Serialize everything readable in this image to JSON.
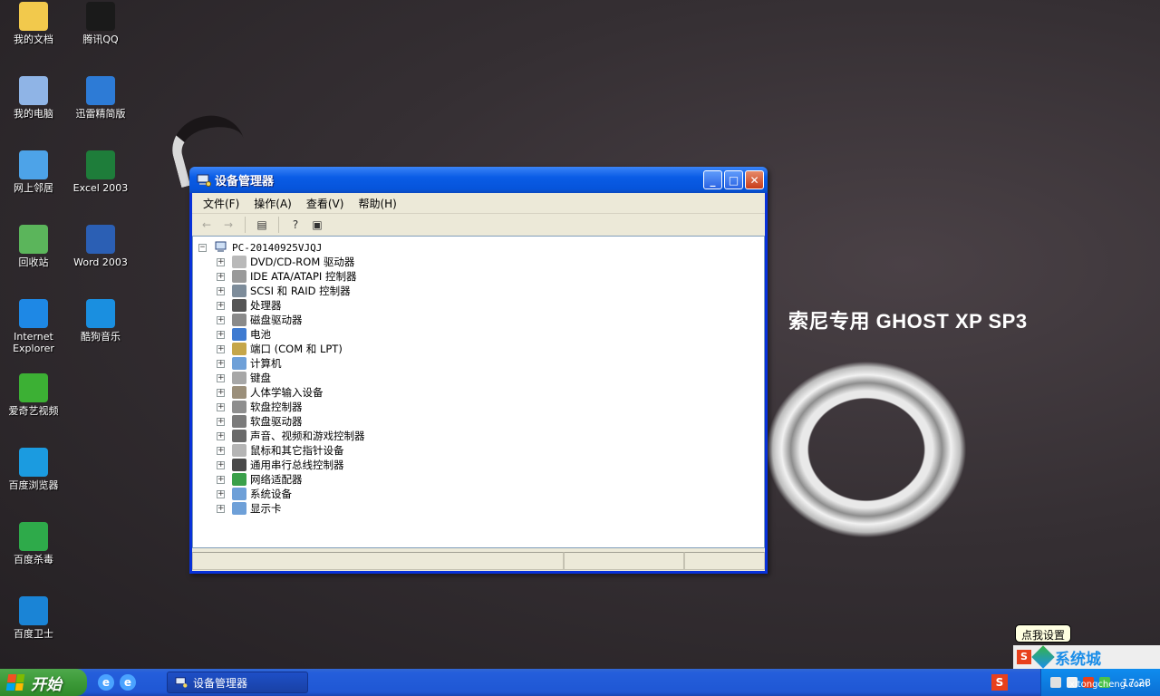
{
  "desktop": {
    "brand_title": "索尼专用 GHOST XP SP3",
    "icons": [
      {
        "label": "我的文档",
        "icon": "folder-icon",
        "color": "#f2c94c"
      },
      {
        "label": "腾讯QQ",
        "icon": "qq-penguin-icon",
        "color": "#1a1a1a"
      },
      {
        "label": "我的电脑",
        "icon": "computer-icon",
        "color": "#8fb4e6"
      },
      {
        "label": "迅雷精简版",
        "icon": "thunder-bird-icon",
        "color": "#2d7bd6"
      },
      {
        "label": "网上邻居",
        "icon": "network-icon",
        "color": "#4da3e8"
      },
      {
        "label": "Excel 2003",
        "icon": "excel-icon",
        "color": "#1e7d3a"
      },
      {
        "label": "回收站",
        "icon": "recycle-bin-icon",
        "color": "#5bb55b"
      },
      {
        "label": "Word 2003",
        "icon": "word-icon",
        "color": "#2b5fb4"
      },
      {
        "label": "Internet Explorer",
        "icon": "ie-icon",
        "color": "#1e88e5"
      },
      {
        "label": "酷狗音乐",
        "icon": "kugou-icon",
        "color": "#1a8fe0"
      },
      {
        "label": "爱奇艺视频",
        "icon": "iqiyi-icon",
        "color": "#3cb034"
      },
      {
        "label": "百度浏览器",
        "icon": "baidu-browser-icon",
        "color": "#1b9be0"
      },
      {
        "label": "百度杀毒",
        "icon": "baidu-antivirus-icon",
        "color": "#2eaa4a"
      },
      {
        "label": "百度卫士",
        "icon": "baidu-guard-icon",
        "color": "#1a84d6"
      }
    ]
  },
  "window": {
    "title": "设备管理器",
    "controls": {
      "minimize": "_",
      "maximize": "□",
      "close": "✕"
    },
    "menu": [
      "文件(F)",
      "操作(A)",
      "查看(V)",
      "帮助(H)"
    ],
    "toolbar": {
      "back": "←",
      "forward": "→",
      "properties": "▤",
      "help": "?",
      "view": "▣"
    },
    "tree": {
      "root_expander": "−",
      "item_expander": "+",
      "root": "PC-20140925VJQJ",
      "items": [
        {
          "label": "DVD/CD-ROM 驱动器",
          "icon": "cdrom-icon",
          "color": "#b9b9b9"
        },
        {
          "label": "IDE ATA/ATAPI 控制器",
          "icon": "ide-controller-icon",
          "color": "#9a9a9a"
        },
        {
          "label": "SCSI 和 RAID 控制器",
          "icon": "scsi-controller-icon",
          "color": "#7d8c9a"
        },
        {
          "label": "处理器",
          "icon": "processor-icon",
          "color": "#555555"
        },
        {
          "label": "磁盘驱动器",
          "icon": "disk-drive-icon",
          "color": "#8a8a8a"
        },
        {
          "label": "电池",
          "icon": "battery-icon",
          "color": "#3f7bd1"
        },
        {
          "label": "端口 (COM 和 LPT)",
          "icon": "port-icon",
          "color": "#c5a64a"
        },
        {
          "label": "计算机",
          "icon": "computer-icon",
          "color": "#6ea0d8"
        },
        {
          "label": "键盘",
          "icon": "keyboard-icon",
          "color": "#a7a7a7"
        },
        {
          "label": "人体学输入设备",
          "icon": "hid-icon",
          "color": "#9b8f7a"
        },
        {
          "label": "软盘控制器",
          "icon": "floppy-controller-icon",
          "color": "#8e8e8e"
        },
        {
          "label": "软盘驱动器",
          "icon": "floppy-drive-icon",
          "color": "#7b7b7b"
        },
        {
          "label": "声音、视频和游戏控制器",
          "icon": "sound-icon",
          "color": "#6a6a6a"
        },
        {
          "label": "鼠标和其它指针设备",
          "icon": "mouse-icon",
          "color": "#b5b5b5"
        },
        {
          "label": "通用串行总线控制器",
          "icon": "usb-icon",
          "color": "#4a4a4a"
        },
        {
          "label": "网络适配器",
          "icon": "network-adapter-icon",
          "color": "#3aa04a"
        },
        {
          "label": "系统设备",
          "icon": "system-device-icon",
          "color": "#6ea0d8"
        },
        {
          "label": "显示卡",
          "icon": "display-adapter-icon",
          "color": "#6ea0d8"
        }
      ]
    }
  },
  "taskbar": {
    "start_label": "开始",
    "quick_launch": [
      {
        "icon": "ie-quick-icon",
        "glyph": "e"
      },
      {
        "icon": "browser-quick-icon",
        "glyph": "e"
      }
    ],
    "task_label": "设备管理器",
    "tray_s": "S",
    "clock": "17:28",
    "balloon": "点我设置",
    "watermark_text": "系统城",
    "watermark_logo": "S",
    "watermark_url": "xitongcheng.com"
  }
}
